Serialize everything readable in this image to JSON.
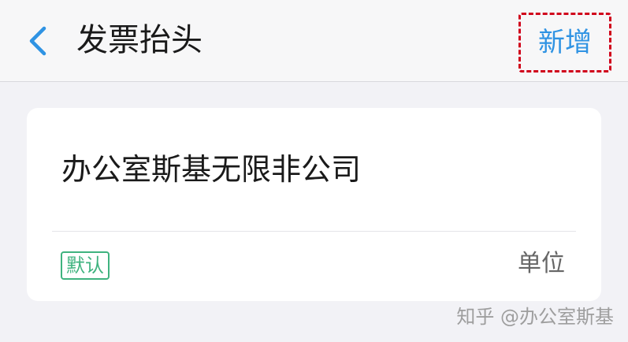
{
  "header": {
    "title": "发票抬头",
    "add_label": "新增",
    "back_icon": "chevron-left-icon",
    "accent_color": "#2f93e3"
  },
  "invoice_card": {
    "company_name": "办公室斯基无限非公司",
    "default_badge": "默认",
    "type_label": "单位",
    "badge_color": "#3fb37f"
  },
  "watermark": {
    "text": "知乎 @办公室斯基"
  }
}
